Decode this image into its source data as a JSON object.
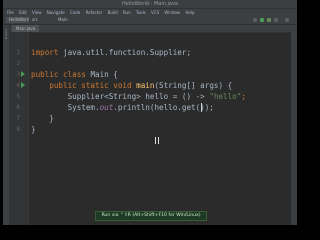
{
  "window": {
    "title": "HelloWorld - Main.java"
  },
  "menubar": [
    "File",
    "Edit",
    "View",
    "Navigate",
    "Code",
    "Refactor",
    "Build",
    "Run",
    "Tools",
    "VCS",
    "Window",
    "Help"
  ],
  "toolbar": {
    "tabs": [
      "HelloWorld",
      "src",
      "Main"
    ]
  },
  "project_strip": {
    "label": "Project"
  },
  "editor": {
    "active_tab": "Main.java",
    "lines": [
      {
        "num": "1",
        "parts": [
          {
            "t": "import ",
            "c": "kw"
          },
          {
            "t": "java.util.function.Supplier;",
            "c": "plain"
          }
        ]
      },
      {
        "num": "2",
        "parts": []
      },
      {
        "num": "3",
        "run": true,
        "parts": [
          {
            "t": "public class ",
            "c": "kw"
          },
          {
            "t": "Main {",
            "c": "plain"
          }
        ]
      },
      {
        "num": "4",
        "run": true,
        "parts": [
          {
            "t": "    public static void ",
            "c": "kw"
          },
          {
            "t": "main",
            "c": "mth"
          },
          {
            "t": "(String[] args) {",
            "c": "plain"
          }
        ]
      },
      {
        "num": "5",
        "parts": [
          {
            "t": "        Supplier<String> hello = () -> ",
            "c": "plain"
          },
          {
            "t": "\"hello\"",
            "c": "str"
          },
          {
            "t": ";",
            "c": "kw"
          }
        ]
      },
      {
        "num": "6",
        "parts": [
          {
            "t": "        System.",
            "c": "plain"
          },
          {
            "t": "out",
            "c": "stat"
          },
          {
            "t": ".println(hello.get());",
            "c": "plain"
          }
        ]
      },
      {
        "num": "7",
        "parts": [
          {
            "t": "    }",
            "c": "plain"
          }
        ]
      },
      {
        "num": "8",
        "parts": [
          {
            "t": "}",
            "c": "plain"
          }
        ]
      }
    ]
  },
  "tooltip": {
    "text": "Run via ⌃⇧R (Alt+Shift+F10 for Win/Linux)"
  }
}
